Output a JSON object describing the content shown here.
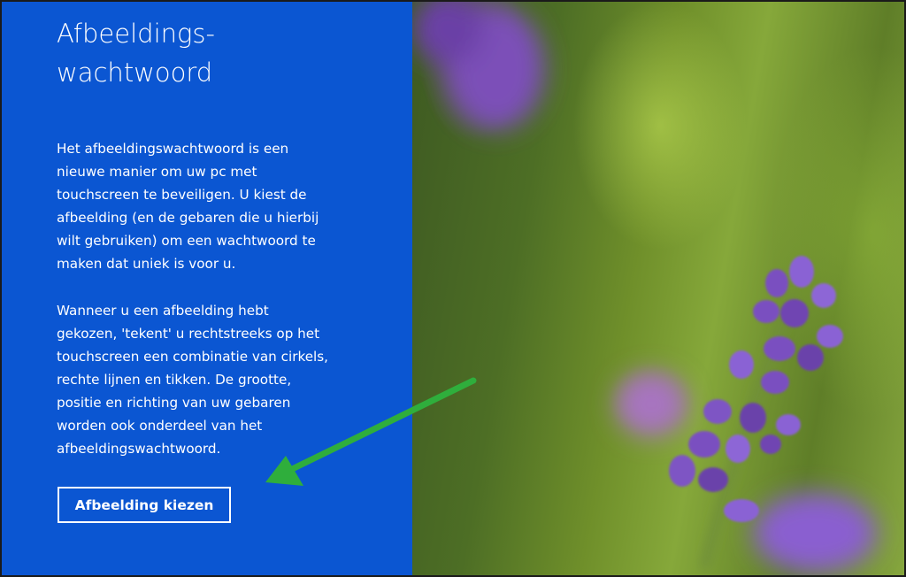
{
  "panel": {
    "title_lines": [
      "Afbeeldings-",
      "wachtwoord"
    ],
    "paragraph1_lines": [
      "Het afbeeldingswachtwoord is een",
      "nieuwe manier om uw pc met",
      "touchscreen te beveiligen. U kiest de",
      "afbeelding (en de gebaren die u hierbij",
      "wilt gebruiken) om een wachtwoord te",
      "maken dat uniek is voor u."
    ],
    "paragraph2_lines": [
      "Wanneer u een afbeelding hebt",
      "gekozen, 'tekent' u rechtstreeks op het",
      "touchscreen een combinatie van cirkels,",
      "rechte lijnen en tikken. De grootte,",
      "positie en richting van uw gebaren",
      "worden ook onderdeel van het",
      "afbeeldingswachtwoord."
    ],
    "choose_button_label": "Afbeelding kiezen"
  },
  "colors": {
    "panel_background": "#0b56d2",
    "text": "#ffffff",
    "annotation_arrow": "#2fae3c"
  },
  "background_image": {
    "subject": "lavender-flower-photo"
  }
}
